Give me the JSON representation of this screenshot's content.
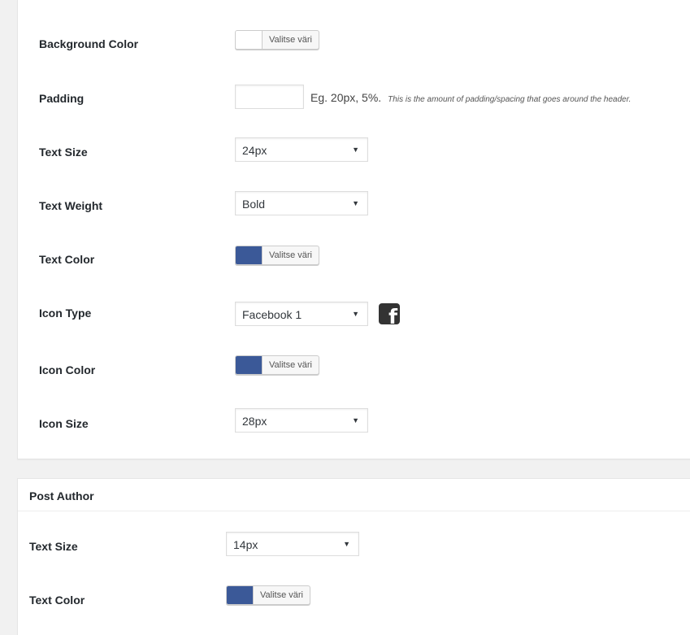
{
  "colors": {
    "picker_blue": "#3b5998",
    "picker_white": "#ffffff",
    "icon_bg": "#333333"
  },
  "color_button_text": "Valitse väri",
  "header_settings": {
    "background_color": {
      "label": "Background Color",
      "swatch": "white"
    },
    "padding": {
      "label": "Padding",
      "value": "",
      "hint": "Eg. 20px, 5%.",
      "description": "This is the amount of padding/spacing that goes around the header."
    },
    "text_size": {
      "label": "Text Size",
      "value": "24px"
    },
    "text_weight": {
      "label": "Text Weight",
      "value": "Bold"
    },
    "text_color": {
      "label": "Text Color",
      "swatch": "blue"
    },
    "icon_type": {
      "label": "Icon Type",
      "value": "Facebook 1",
      "icon": "facebook-square-icon"
    },
    "icon_color": {
      "label": "Icon Color",
      "swatch": "blue"
    },
    "icon_size": {
      "label": "Icon Size",
      "value": "28px"
    }
  },
  "post_author": {
    "title": "Post Author",
    "text_size": {
      "label": "Text Size",
      "value": "14px"
    },
    "text_color": {
      "label": "Text Color",
      "swatch": "blue"
    }
  },
  "caret_glyph": "▼",
  "facebook_glyph": "f"
}
